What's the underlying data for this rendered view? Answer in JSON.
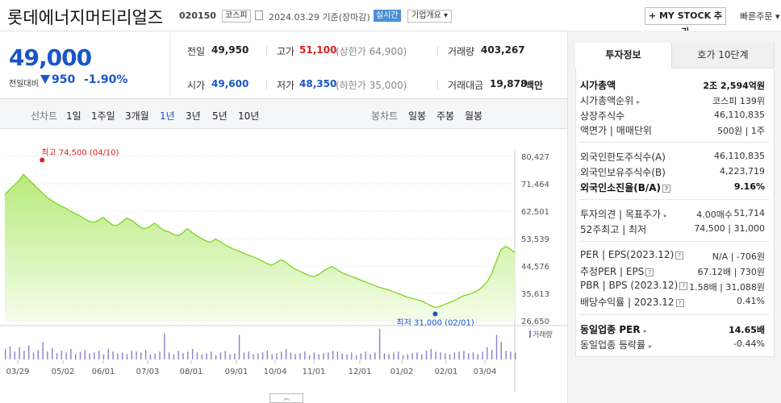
{
  "header": {
    "stock_name": "롯데에너지머티리얼즈",
    "stock_code": "020150",
    "market": "코스피",
    "date": "2024.03.29 기준(장마감)",
    "realtime": "실시간",
    "company_overview": "기업개요 ▾",
    "mystock_button": "+ MY STOCK 추가",
    "quick_order": "빠른주문 ▾"
  },
  "price": {
    "current": "49,000",
    "change_label": "전일대비",
    "change": "950",
    "change_pct": "-1.90%"
  },
  "quotes": {
    "prev_close_label": "전일",
    "prev_close": "49,950",
    "high_label": "고가",
    "high": "51,100",
    "upper_limit": "(상한가 64,900)",
    "volume_label": "거래량",
    "volume": "403,267",
    "open_label": "시가",
    "open": "49,600",
    "low_label": "저가",
    "low": "48,350",
    "lower_limit": "(하한가 35,000)",
    "amount_label": "거래대금",
    "amount": "19,878",
    "amount_unit": "백만"
  },
  "tabs": {
    "line_chart_title": "선차트",
    "line_periods": [
      "1일",
      "1주일",
      "3개월",
      "1년",
      "3년",
      "5년",
      "10년"
    ],
    "active_period": "1년",
    "candle_title": "봉차트",
    "candle_periods": [
      "일봉",
      "주봉",
      "월봉"
    ]
  },
  "chart_data": {
    "type": "area",
    "y_ticks": [
      "80,427",
      "71,464",
      "62,501",
      "53,539",
      "44,576",
      "35,613",
      "26,650"
    ],
    "ylim": [
      26650,
      80427
    ],
    "x_labels": [
      "03/29",
      "05/02",
      "06/01",
      "07/03",
      "08/01",
      "09/01",
      "10/04",
      "11/01",
      "12/01",
      "01/02",
      "02/01",
      "03/04"
    ],
    "high_annotation": "최고 74,500 (04/10)",
    "low_annotation": "최저 31,000 (02/01)",
    "volume_label": "거래량",
    "prices": [
      68000,
      69500,
      71000,
      72500,
      74500,
      73000,
      71500,
      70000,
      68500,
      67000,
      66000,
      65000,
      64200,
      63500,
      62500,
      61800,
      61000,
      60000,
      59200,
      58800,
      59500,
      60500,
      59200,
      58000,
      57800,
      59000,
      60200,
      59600,
      58500,
      57200,
      56800,
      57500,
      58600,
      57400,
      56200,
      55800,
      54900,
      54500,
      55400,
      56800,
      55600,
      54400,
      53600,
      52800,
      52300,
      53400,
      52600,
      51600,
      50800,
      50000,
      49500,
      48800,
      48200,
      47600,
      47000,
      46200,
      45400,
      44800,
      45600,
      46600,
      45900,
      44600,
      43600,
      42900,
      42200,
      41500,
      41100,
      41700,
      42800,
      43800,
      44400,
      43400,
      42400,
      41800,
      41200,
      40600,
      40000,
      39400,
      38800,
      38200,
      37600,
      37200,
      36800,
      36200,
      35600,
      35000,
      34400,
      34000,
      33600,
      33200,
      32400,
      31600,
      31000,
      31300,
      32000,
      32600,
      33200,
      34000,
      34800,
      35200,
      35800,
      36400,
      37600,
      39200,
      41800,
      45800,
      49800,
      51000,
      50200,
      49000
    ],
    "volumes": [
      12,
      15,
      9,
      14,
      10,
      16,
      8,
      11,
      20,
      9,
      13,
      7,
      10,
      8,
      12,
      6,
      9,
      11,
      7,
      8,
      10,
      6,
      12,
      9,
      7,
      8,
      6,
      10,
      9,
      8,
      11,
      6,
      7,
      9,
      30,
      8,
      6,
      10,
      7,
      9,
      12,
      8,
      6,
      7,
      9,
      5,
      8,
      10,
      6,
      7,
      28,
      8,
      9,
      6,
      7,
      8,
      10,
      6,
      7,
      9,
      12,
      8,
      6,
      7,
      9,
      5,
      8,
      6,
      7,
      8,
      10,
      9,
      7,
      6,
      8,
      5,
      7,
      9,
      6,
      8,
      35,
      7,
      6,
      8,
      9,
      5,
      6,
      7,
      8,
      6,
      10,
      12,
      9,
      8,
      7,
      6,
      8,
      9,
      10,
      7,
      8,
      6,
      9,
      14,
      11,
      28,
      20,
      10,
      9,
      8
    ]
  },
  "invest_info": {
    "tab_invest": "투자정보",
    "tab_hoga": "호가 10단계",
    "rows": [
      {
        "label": "시가총액",
        "value": "2조 2,594억원",
        "bold": true
      },
      {
        "label": "시가총액순위",
        "value": "코스피 139위"
      },
      {
        "label": "상장주식수",
        "value": "46,110,835"
      },
      {
        "label": "액면가 | 매매단위",
        "value": "500원 | 1주"
      },
      {
        "label": "외국인한도주식수(A)",
        "value": "46,110,835"
      },
      {
        "label": "외국인보유주식수(B)",
        "value": "4,223,719"
      },
      {
        "label": "외국인소진율(B/A)",
        "value": "9.16%",
        "bold": true
      },
      {
        "label": "투자의견 | 목표주가",
        "value_opinion": "4.00매수",
        "value": "51,714"
      },
      {
        "label": "52주최고 | 최저",
        "value": "74,500 | 31,000"
      },
      {
        "label": "PER | EPS(2023.12)",
        "value": "N/A | -706원"
      },
      {
        "label": "추정PER | EPS",
        "value": "67.12배 | 730원"
      },
      {
        "label": "PBR | BPS (2023.12)",
        "value": "1.58배 | 31,088원"
      },
      {
        "label": "배당수익률 | 2023.12",
        "value": "0.41%"
      },
      {
        "label": "동일업종 PER",
        "value": "14.65배",
        "bold": true
      },
      {
        "label": "동일업종 등락률",
        "value": "-0.44%"
      }
    ]
  },
  "colors": {
    "accent_blue": "#1a55c8",
    "red": "#d91f1f",
    "chart_line": "#7ed321",
    "chart_fill_top": "#b7ea7a",
    "chart_fill_bottom": "#f4fde9"
  }
}
